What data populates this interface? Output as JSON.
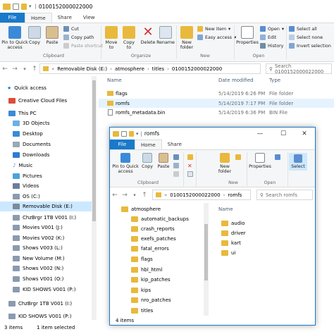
{
  "main": {
    "title_bar": {
      "path": "0100152000022000"
    },
    "tabs": [
      "File",
      "Home",
      "Share",
      "View"
    ],
    "ribbon": {
      "pin": "Pin to Quick access",
      "copy": "Copy",
      "paste": "Paste",
      "cut": "Cut",
      "copy_path": "Copy path",
      "paste_shortcut": "Paste shortcut",
      "move_to": "Move to",
      "copy_to": "Copy to",
      "delete": "Delete",
      "rename": "Rename",
      "new_folder": "New folder",
      "new_item": "New item",
      "easy_access": "Easy access",
      "properties": "Properties",
      "open": "Open",
      "edit": "Edit",
      "history": "History",
      "select_all": "Select all",
      "select_none": "Select none",
      "invert_selection": "Invert selection",
      "groups": [
        "Clipboard",
        "Organize",
        "New",
        "Open"
      ]
    },
    "address": {
      "crumbs": [
        "Removable Disk (E:)",
        "atmosphere",
        "titles",
        "0100152000022000"
      ],
      "search_placeholder": "Search 0100152000022000"
    },
    "nav_pane": [
      "Quick access",
      "Creative Cloud Files",
      "This PC",
      "3D Objects",
      "Desktop",
      "Documents",
      "Downloads",
      "Music",
      "Pictures",
      "Videos",
      "OS (C:)",
      "Removable Disk (E:)",
      "ChzBrgr 1TB V001 (I:)",
      "Movies V001 (J:)",
      "Movies V002 (K:)",
      "Shows V003 (L:)",
      "New Volume (M:)",
      "Shows V002 (N:)",
      "Shows V001 (O:)",
      "KID SHOWS V001 (P:)",
      "ChzBrgr 1TB V001 (I:)",
      "KID SHOWS V001 (P:)"
    ],
    "columns": [
      "Name",
      "Date modified",
      "Type"
    ],
    "files": [
      {
        "name": "flags",
        "date": "5/14/2019 6:26 PM",
        "type": "File folder"
      },
      {
        "name": "romfs",
        "date": "5/14/2019 7:17 PM",
        "type": "File folder"
      },
      {
        "name": "romfs_metadata.bin",
        "date": "5/14/2019 6:36 PM",
        "type": "BIN File"
      }
    ],
    "status": {
      "count": "3 items",
      "selected": "1 item selected"
    }
  },
  "child": {
    "title": "romfs",
    "tabs": [
      "File",
      "Home",
      "Share"
    ],
    "ribbon": {
      "pin": "Pin to Quick access",
      "copy": "Copy",
      "paste": "Paste",
      "new_folder": "New folder",
      "properties": "Properties",
      "select": "Select",
      "groups": [
        "Clipboard",
        "New",
        "Open"
      ]
    },
    "address": {
      "crumbs": [
        "0100152000022000",
        "romfs"
      ],
      "search_placeholder": "Search romfs"
    },
    "nav_tree": [
      "atmosphere",
      "automatic_backups",
      "crash_reports",
      "exefs_patches",
      "fatal_errors",
      "flags",
      "hbl_html",
      "kip_patches",
      "kips",
      "nro_patches",
      "titles"
    ],
    "column_name": "Name",
    "files": [
      "audio",
      "driver",
      "kart",
      "ui"
    ],
    "status": "4 items"
  },
  "colors": {
    "accent": "#1979ca",
    "folder": "#e8b93c",
    "selected": "#cce8ff"
  }
}
